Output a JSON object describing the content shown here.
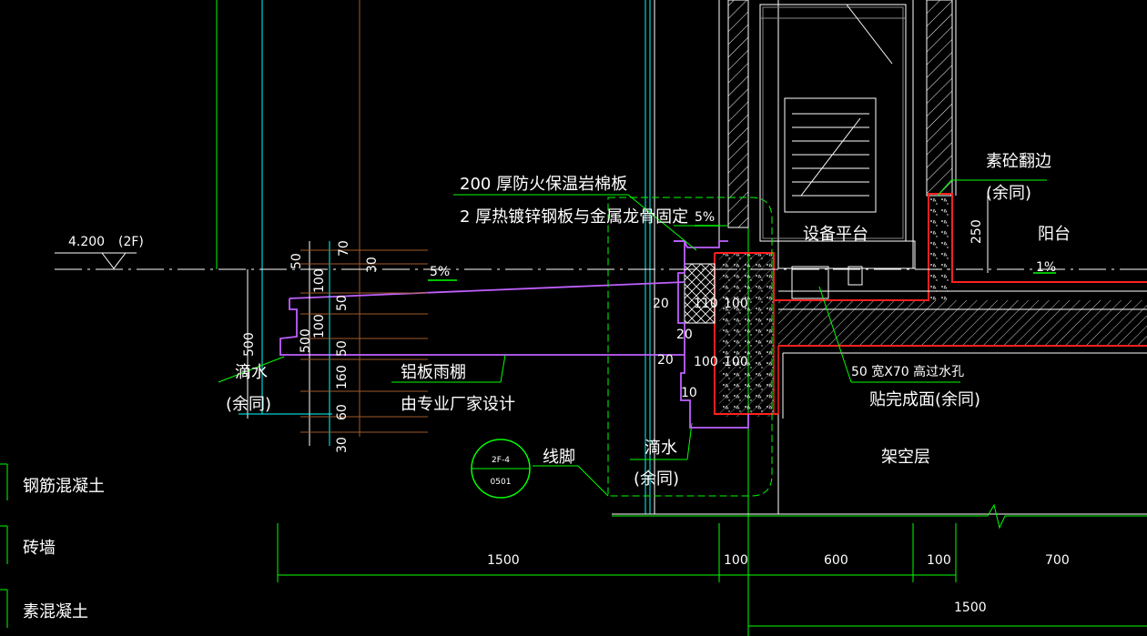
{
  "labels": {
    "level": "4.200",
    "floor": "(2F)",
    "insulation": "200  厚防火保温岩棉板",
    "steel_plate": "2 厚热镀锌钢板与金属龙骨固定",
    "slope_left": "5%",
    "slope_mid": "5%",
    "slope_right": "1%",
    "equipment_platform": "设备平台",
    "concrete_upturn": "素砼翻边",
    "same_below_1": "(余同)",
    "balcony": "阳台",
    "dim_250": "250",
    "drip_left": "滴水",
    "same_below_2": "(余同)",
    "canopy": "铝板雨棚",
    "canopy_designer": "由专业厂家设计",
    "baseboard": "线脚",
    "drip_mid": "滴水",
    "same_below_3": "(余同)",
    "drain_hole": "50  宽X70  高过水孔",
    "tile_finish": "贴完成面(余同)",
    "stilt_floor": "架空层",
    "detail_ref_top": "2F-4",
    "detail_ref_bottom": "0501"
  },
  "small_dims": {
    "d70": "70",
    "d30a": "30",
    "d50a": "50",
    "d100a": "100",
    "d50b": "50",
    "d100b": "100",
    "d500": "500",
    "d50c": "50",
    "d160": "160",
    "d60": "60",
    "d30b": "30",
    "d500v": "500",
    "d20a": "20",
    "d110": "110",
    "d100c": "100",
    "d20b": "20",
    "d20c": "20",
    "d100d": "100",
    "d100e": "100",
    "d10": "10"
  },
  "bottom_dims": {
    "d1500a": "1500",
    "d100f": "100",
    "d600": "600",
    "d100g": "100",
    "d700": "700",
    "d1500b": "1500"
  },
  "legend": [
    {
      "label": "钢筋混凝土"
    },
    {
      "label": "砖墙"
    },
    {
      "label": "素混凝土"
    }
  ],
  "colors": {
    "background": "#000000",
    "green": "#00ff00",
    "cyan": "#00ffff",
    "magenta": "#c060ff",
    "red": "#ff2020",
    "white": "#ffffff",
    "brown": "#a05a2c",
    "yellow": "#ffff00"
  }
}
